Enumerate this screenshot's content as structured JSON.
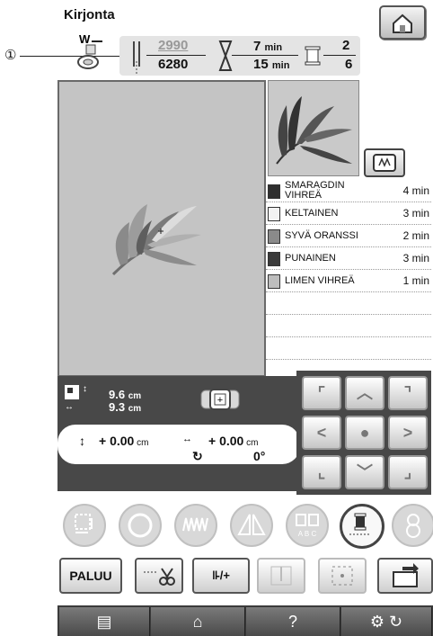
{
  "header": {
    "title": "Kirjonta",
    "callout": "①"
  },
  "stats": {
    "stitch_current": "2990",
    "stitch_total": "6280",
    "time_current": "7",
    "time_total": "15",
    "time_unit": "min",
    "color_current": "2",
    "color_total": "6",
    "presser_label": "W"
  },
  "colors": [
    {
      "name": "SMARAGDIN VIHREÄ",
      "time": "4 min",
      "swatch": "#2f2f2f"
    },
    {
      "name": "KELTAINEN",
      "time": "3 min",
      "swatch": "#f2f2f2"
    },
    {
      "name": "SYVÄ ORANSSI",
      "time": "2 min",
      "swatch": "#8a8a8a"
    },
    {
      "name": "PUNAINEN",
      "time": "3 min",
      "swatch": "#3a3a3a"
    },
    {
      "name": "LIMEN VIHREÄ",
      "time": "1 min",
      "swatch": "#bdbdbd"
    }
  ],
  "size": {
    "width": "9.6",
    "height": "9.3",
    "unit": "cm"
  },
  "move": {
    "x_sign": "+",
    "x": "0.00",
    "y_sign": "+",
    "y": "0.00",
    "unit": "cm",
    "angle": "0°"
  },
  "buttons": {
    "back": "PALUU",
    "thread_tension": "-/+",
    "help": "?"
  }
}
